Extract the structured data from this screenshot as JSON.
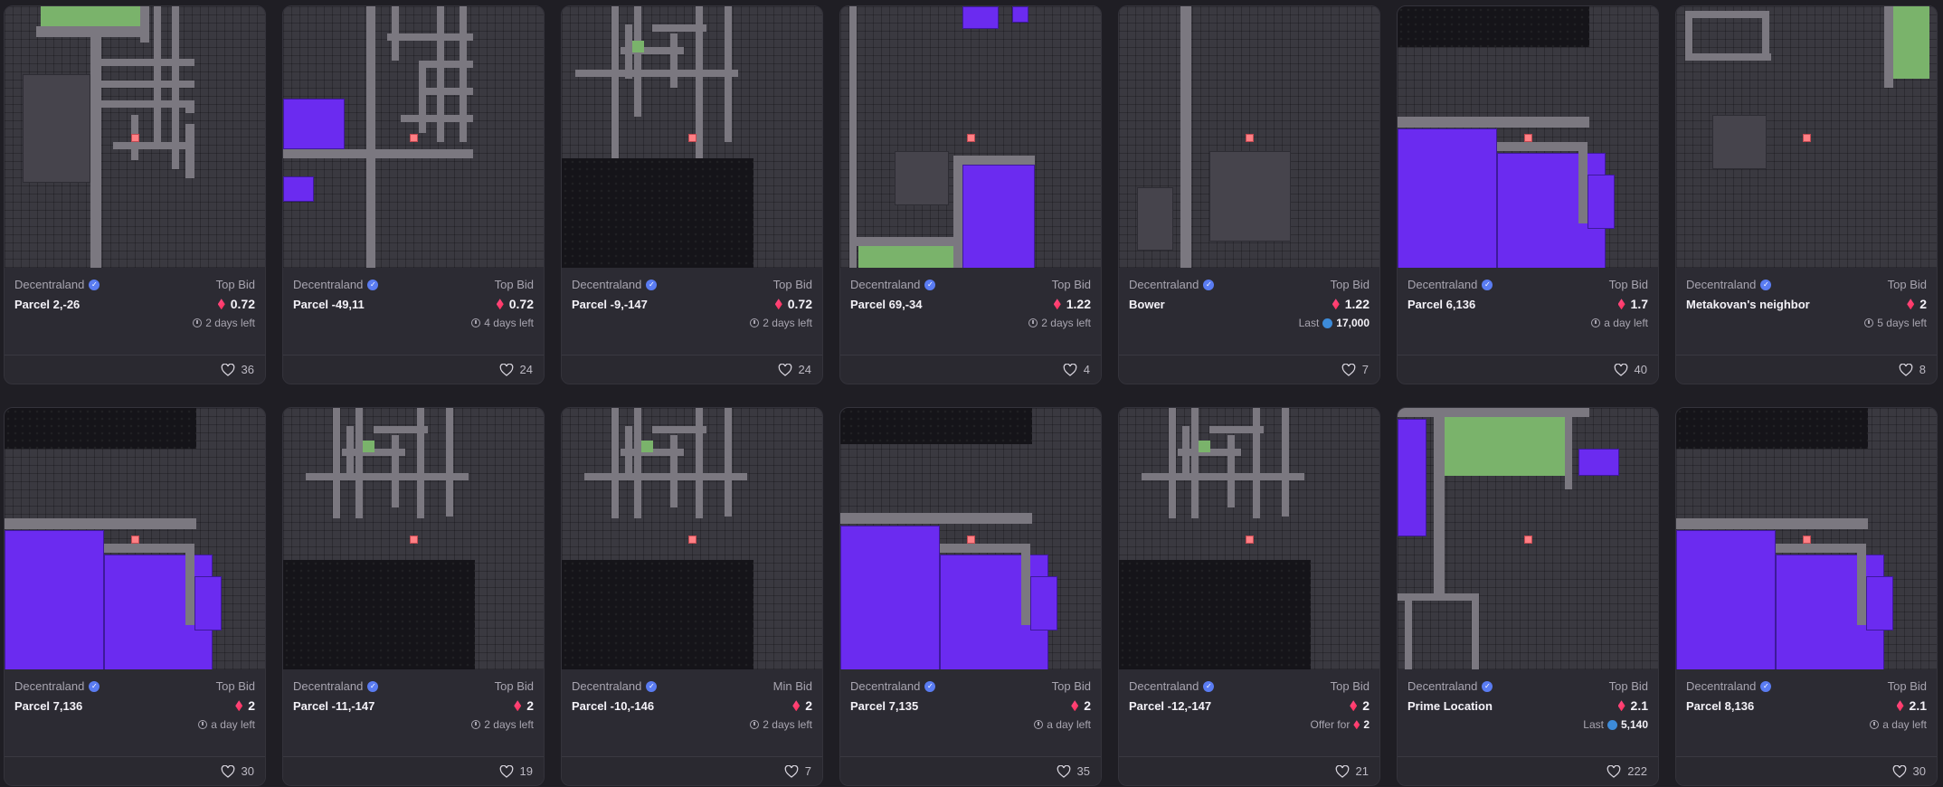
{
  "cards": [
    {
      "collection": "Decentraland",
      "name": "Parcel 2,-26",
      "bid_label": "Top Bid",
      "price": "0.72",
      "sub": "2 days left",
      "sub_type": "time",
      "likes": "36",
      "map": "a"
    },
    {
      "collection": "Decentraland",
      "name": "Parcel -49,11",
      "bid_label": "Top Bid",
      "price": "0.72",
      "sub": "4 days left",
      "sub_type": "time",
      "likes": "24",
      "map": "b"
    },
    {
      "collection": "Decentraland",
      "name": "Parcel -9,-147",
      "bid_label": "Top Bid",
      "price": "0.72",
      "sub": "2 days left",
      "sub_type": "time",
      "likes": "24",
      "map": "c"
    },
    {
      "collection": "Decentraland",
      "name": "Parcel 69,-34",
      "bid_label": "Top Bid",
      "price": "1.22",
      "sub": "2 days left",
      "sub_type": "time",
      "likes": "4",
      "map": "d"
    },
    {
      "collection": "Decentraland",
      "name": "Bower",
      "bid_label": "Top Bid",
      "price": "1.22",
      "sub_prefix": "Last",
      "sub": "17,000",
      "sub_type": "last",
      "likes": "7",
      "map": "e"
    },
    {
      "collection": "Decentraland",
      "name": "Parcel 6,136",
      "bid_label": "Top Bid",
      "price": "1.7",
      "sub": "a day left",
      "sub_type": "time",
      "likes": "40",
      "map": "f"
    },
    {
      "collection": "Decentraland",
      "name": "Metakovan's neighbor",
      "bid_label": "Top Bid",
      "price": "2",
      "sub": "5 days left",
      "sub_type": "time",
      "likes": "8",
      "map": "g"
    },
    {
      "collection": "Decentraland",
      "name": "Parcel 7,136",
      "bid_label": "Top Bid",
      "price": "2",
      "sub": "a day left",
      "sub_type": "time",
      "likes": "30",
      "map": "f2"
    },
    {
      "collection": "Decentraland",
      "name": "Parcel -11,-147",
      "bid_label": "Top Bid",
      "price": "2",
      "sub": "2 days left",
      "sub_type": "time",
      "likes": "19",
      "map": "c2"
    },
    {
      "collection": "Decentraland",
      "name": "Parcel -10,-146",
      "bid_label": "Min Bid",
      "price": "2",
      "sub": "2 days left",
      "sub_type": "time",
      "likes": "7",
      "map": "c2"
    },
    {
      "collection": "Decentraland",
      "name": "Parcel 7,135",
      "bid_label": "Top Bid",
      "price": "2",
      "sub": "a day left",
      "sub_type": "time",
      "likes": "35",
      "map": "f3"
    },
    {
      "collection": "Decentraland",
      "name": "Parcel -12,-147",
      "bid_label": "Top Bid",
      "price": "2",
      "sub_prefix": "Offer for",
      "sub": "2",
      "sub_type": "offer",
      "likes": "21",
      "map": "c2"
    },
    {
      "collection": "Decentraland",
      "name": "Prime Location",
      "bid_label": "Top Bid",
      "price": "2.1",
      "sub_prefix": "Last",
      "sub": "5,140",
      "sub_type": "last",
      "likes": "222",
      "map": "h"
    },
    {
      "collection": "Decentraland",
      "name": "Parcel 8,136",
      "bid_label": "Top Bid",
      "price": "2.1",
      "sub": "a day left",
      "sub_type": "time",
      "likes": "30",
      "map": "f2"
    }
  ],
  "colors": {
    "estate": "#6b2bf0",
    "plaza": "#7ab36b",
    "road": "#7b7880",
    "pin": "#ff7f84",
    "mana": "#ff2d55",
    "verified": "#5a7cf2"
  },
  "icons": {
    "verified": "verified-check-icon",
    "currency": "mana-diamond-icon",
    "time": "clock-icon",
    "eth": "eth-icon",
    "like": "heart-icon"
  }
}
